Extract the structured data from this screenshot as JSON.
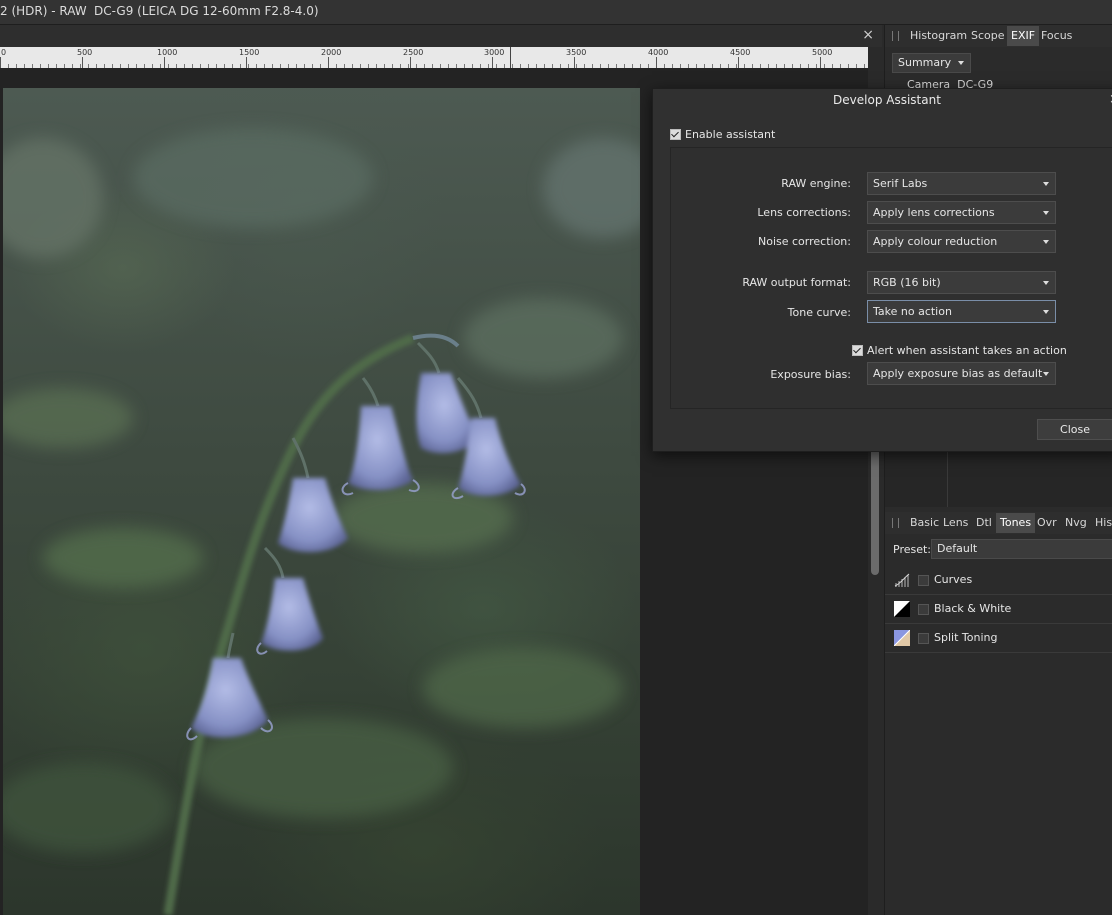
{
  "titlebar": {
    "document_title": "2 (HDR) - RAW",
    "camera_info": "DC-G9 (LEICA DG 12-60mm F2.8-4.0)"
  },
  "document_bar": {
    "close_glyph": "×"
  },
  "ruler": {
    "labels": [
      "0",
      "500",
      "1000",
      "1500",
      "2000",
      "2500",
      "3000",
      "3500",
      "4000",
      "4500",
      "5000"
    ]
  },
  "info_panel": {
    "tabs": [
      "Histogram",
      "Scope",
      "EXIF",
      "Focus"
    ],
    "active_tab": "EXIF",
    "dropdown": "Summary",
    "camera_row": "Camera  DC-G9"
  },
  "develop_panel": {
    "tabs": [
      "Basic",
      "Lens",
      "Dtl",
      "Tones",
      "Ovr",
      "Nvg",
      "His"
    ],
    "active_tab": "Tones",
    "preset_label": "Preset:",
    "preset_value": "Default",
    "adjustments": [
      {
        "label": "Curves",
        "icon": "curves-icon"
      },
      {
        "label": "Black & White",
        "icon": "black-white-icon"
      },
      {
        "label": "Split Toning",
        "icon": "split-toning-icon"
      }
    ]
  },
  "dialog": {
    "title": "Develop Assistant",
    "close_glyph": "×",
    "enable_label": "Enable assistant",
    "enable_checked": true,
    "fields": {
      "raw_engine": {
        "label": "RAW engine:",
        "value": "Serif Labs"
      },
      "lens": {
        "label": "Lens corrections:",
        "value": "Apply lens corrections"
      },
      "noise": {
        "label": "Noise correction:",
        "value": "Apply colour reduction"
      },
      "output": {
        "label": "RAW output format:",
        "value": "RGB (16 bit)"
      },
      "tone": {
        "label": "Tone curve:",
        "value": "Take no action"
      },
      "exposure": {
        "label": "Exposure bias:",
        "value": "Apply exposure bias as default"
      }
    },
    "alert_label": "Alert when assistant takes an action",
    "alert_checked": true,
    "close_button": "Close"
  },
  "colors": {
    "panel_bg": "#2b2b2b",
    "dialog_bg": "#303030",
    "focus_border": "#7a8ea8",
    "flower": "#8c96c8"
  }
}
